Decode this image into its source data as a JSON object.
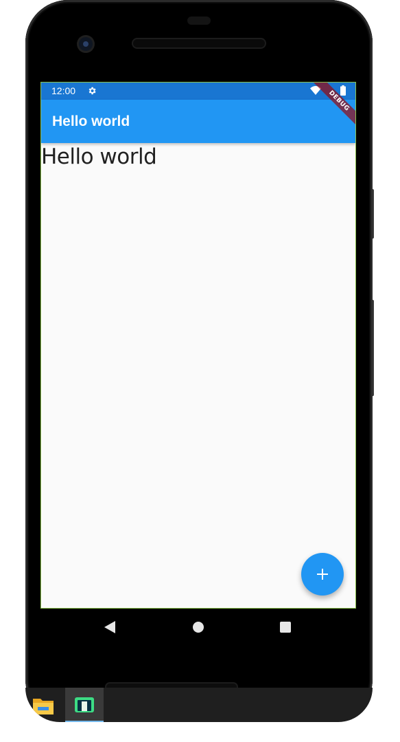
{
  "status_bar": {
    "time": "12:00",
    "icons": [
      "settings-gear-icon",
      "wifi-icon",
      "battery-icon"
    ],
    "color": "#1976d2"
  },
  "app_bar": {
    "title": "Hello world",
    "color": "#2196f3"
  },
  "content": {
    "text": "Hello world"
  },
  "debug_banner": {
    "label": "DEBUG"
  },
  "fab": {
    "icon": "plus-icon",
    "color": "#2196f3"
  },
  "nav_bar": {
    "buttons": [
      "back-icon",
      "home-icon",
      "recents-icon"
    ]
  },
  "taskbar": {
    "items": [
      "file-explorer-icon",
      "android-studio-icon"
    ],
    "active_index": 1
  }
}
